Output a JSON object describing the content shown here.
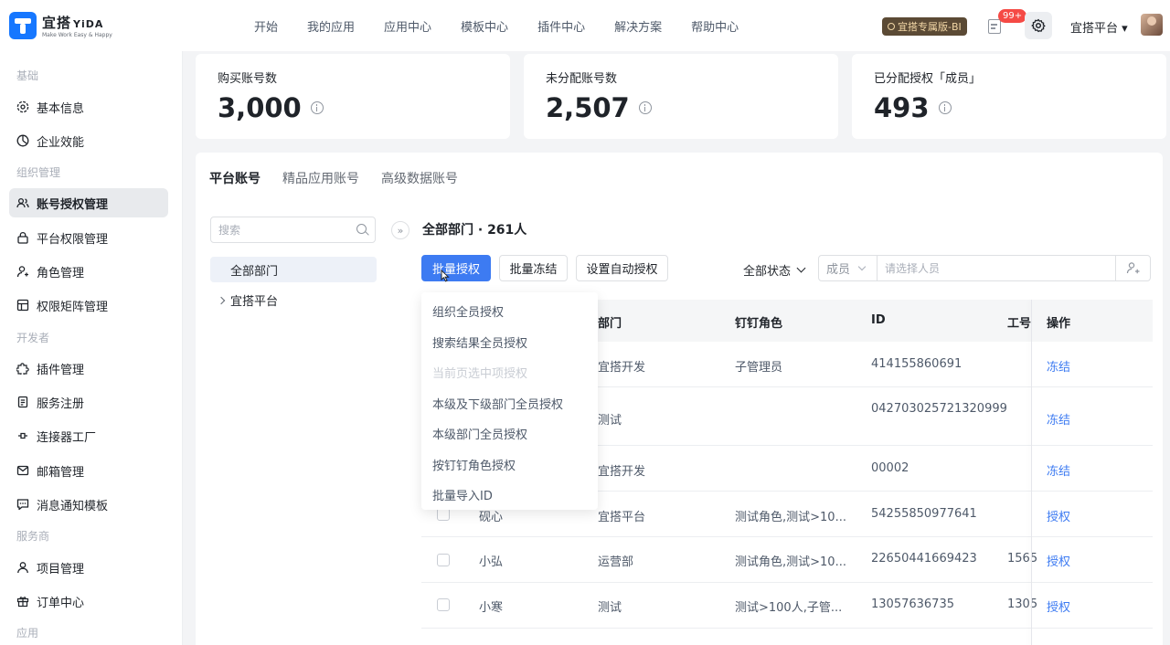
{
  "header": {
    "logo_text": "宜搭",
    "logo_brand": "YiDA",
    "logo_slogan": "Make Work Easy & Happy",
    "nav": [
      "开始",
      "我的应用",
      "应用中心",
      "模板中心",
      "插件中心",
      "解决方案",
      "帮助中心"
    ],
    "edition_badge": "宜搭专属版-BI",
    "notification_count": "99+",
    "org_name": "宜搭平台"
  },
  "sidebar": {
    "groups": [
      {
        "title": "基础",
        "items": [
          {
            "label": "基本信息",
            "icon": "settings-icon"
          },
          {
            "label": "企业效能",
            "icon": "chart-icon"
          }
        ]
      },
      {
        "title": "组织管理",
        "items": [
          {
            "label": "账号授权管理",
            "icon": "users-icon",
            "active": true
          },
          {
            "label": "平台权限管理",
            "icon": "lock-icon"
          },
          {
            "label": "角色管理",
            "icon": "user-role-icon"
          },
          {
            "label": "权限矩阵管理",
            "icon": "grid-icon"
          }
        ]
      },
      {
        "title": "开发者",
        "items": [
          {
            "label": "插件管理",
            "icon": "puzzle-icon"
          },
          {
            "label": "服务注册",
            "icon": "document-icon"
          },
          {
            "label": "连接器工厂",
            "icon": "connector-icon"
          },
          {
            "label": "邮箱管理",
            "icon": "mail-icon"
          },
          {
            "label": "消息通知模板",
            "icon": "message-icon"
          }
        ]
      },
      {
        "title": "服务商",
        "items": [
          {
            "label": "项目管理",
            "icon": "person-icon"
          },
          {
            "label": "订单中心",
            "icon": "gift-icon"
          }
        ]
      },
      {
        "title": "应用",
        "items": []
      }
    ]
  },
  "stats": [
    {
      "label": "购买账号数",
      "value": "3,000"
    },
    {
      "label": "未分配账号数",
      "value": "2,507"
    },
    {
      "label": "已分配授权「成员」",
      "value": "493"
    }
  ],
  "tabs": [
    "平台账号",
    "精品应用账号",
    "高级数据账号"
  ],
  "dept_panel": {
    "search_placeholder": "搜索",
    "all_label": "全部部门",
    "tree_node": "宜搭平台"
  },
  "content": {
    "title": "全部部门 · 261人",
    "buttons": {
      "batch_grant": "批量授权",
      "batch_freeze": "批量冻结",
      "auto_grant": "设置自动授权"
    },
    "status_filter": "全部状态",
    "member_type": "成员",
    "member_placeholder": "请选择人员"
  },
  "dropdown": {
    "items": [
      {
        "label": "组织全员授权",
        "disabled": false
      },
      {
        "label": "搜索结果全员授权",
        "disabled": false
      },
      {
        "label": "当前页选中项授权",
        "disabled": true
      },
      {
        "label": "本级及下级部门全员授权",
        "disabled": false
      },
      {
        "label": "本级部门全员授权",
        "disabled": false
      },
      {
        "label": "按钉钉角色授权",
        "disabled": false
      },
      {
        "label": "批量导入ID",
        "disabled": false
      }
    ]
  },
  "table": {
    "columns": {
      "dept": "部门",
      "role": "钉钉角色",
      "id": "ID",
      "job_no": "工号",
      "ops": "操作"
    },
    "rows": [
      {
        "name": "",
        "dept": "宜搭开发",
        "role": "子管理员",
        "id": "414155860691",
        "job_no": "",
        "op": "冻结"
      },
      {
        "name": "",
        "dept": "测试",
        "role": "",
        "id": "042703025721320999",
        "job_no": "",
        "op": "冻结"
      },
      {
        "name": "",
        "dept": "宜搭开发",
        "role": "",
        "id": "00002",
        "job_no": "",
        "op": "冻结"
      },
      {
        "name": "砚心",
        "dept": "宜搭平台",
        "role": "测试角色,测试>10...",
        "id": "54255850977641",
        "job_no": "",
        "op": "授权"
      },
      {
        "name": "小弘",
        "dept": "运营部",
        "role": "测试角色,测试>10...",
        "id": "22650441669423",
        "job_no": "1565",
        "op": "授权"
      },
      {
        "name": "小寒",
        "dept": "测试",
        "role": "测试>100人,子管...",
        "id": "13057636735",
        "job_no": "1305",
        "op": "授权"
      }
    ]
  },
  "colors": {
    "primary": "#3d7bf2",
    "link": "#3d7bf2",
    "active_bg": "#e8eaed",
    "badge": "#f54a45"
  }
}
